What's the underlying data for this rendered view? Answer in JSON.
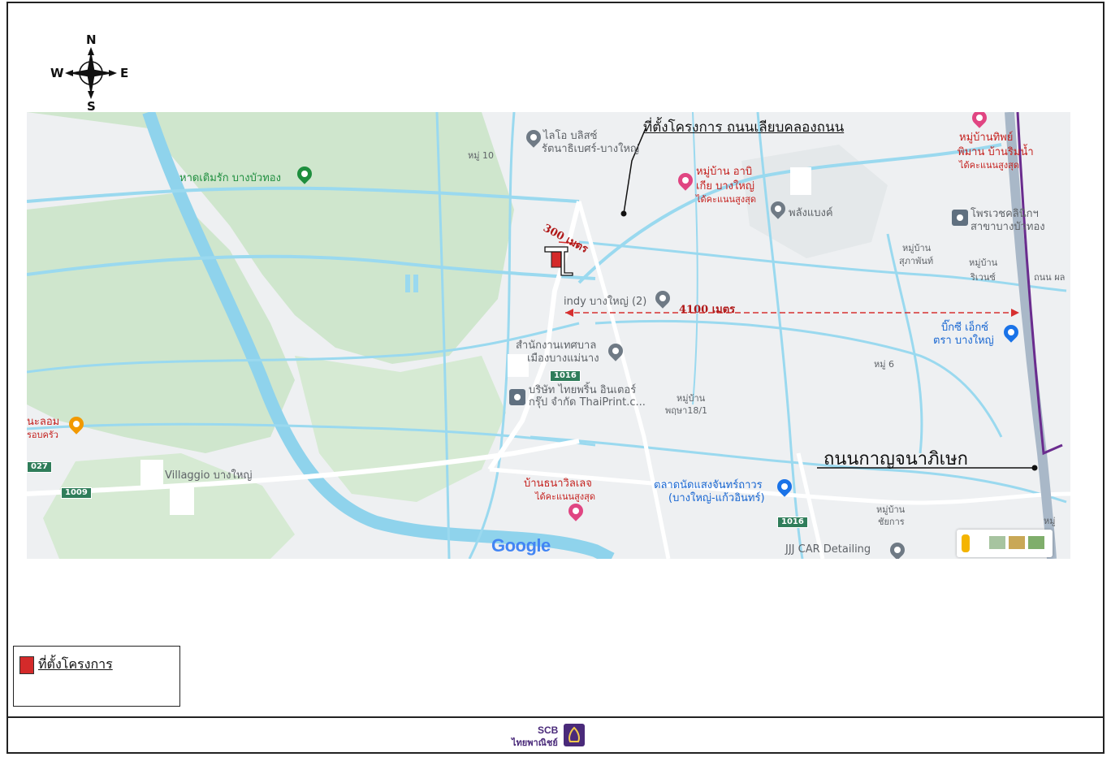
{
  "compass": {
    "north": "N",
    "south": "S",
    "east": "E",
    "west": "W"
  },
  "map": {
    "pois": [
      {
        "text": "ไลโอ บลิสซ์",
        "style": "grey"
      },
      {
        "text": "รัตนาธิเบศร์-บางใหญ่",
        "style": "grey"
      },
      {
        "text": "หมู่ 10",
        "style": "grey"
      },
      {
        "text": "หาดเติมรัก บางบัวทอง",
        "style": "green"
      },
      {
        "text": "หมู่บ้าน อาบิ",
        "style": "pink"
      },
      {
        "text": "เกีย บางใหญ่",
        "style": "pink"
      },
      {
        "text": "ได้คะแนนสูงสุด",
        "style": "pink"
      },
      {
        "text": "พลังแบงค์",
        "style": "grey"
      },
      {
        "text": "หมู่บ้านทิพย์",
        "style": "pink"
      },
      {
        "text": "พิมาน บ้านริมน้ำ",
        "style": "pink"
      },
      {
        "text": "ได้คะแนนสูงสุด",
        "style": "pink"
      },
      {
        "text": "โพรเวชคลินิกฯ",
        "style": "grey"
      },
      {
        "text": "สาขาบางบัวทอง",
        "style": "grey"
      },
      {
        "text": "หมู่บ้าน",
        "style": "grey"
      },
      {
        "text": "สุภาพันท์",
        "style": "grey"
      },
      {
        "text": "หมู่บ้าน",
        "style": "grey"
      },
      {
        "text": "ริเวนซ์",
        "style": "grey"
      },
      {
        "text": "ถนน ผล",
        "style": "grey"
      },
      {
        "text": "indy บางใหญ่ (2)",
        "style": "grey"
      },
      {
        "text": "บิ๊กซี เอ็กซ์",
        "style": "blue"
      },
      {
        "text": "ตรา บางใหญ่",
        "style": "blue"
      },
      {
        "text": "สำนักงานเทศบาล",
        "style": "grey"
      },
      {
        "text": "เมืองบางแม่นาง",
        "style": "grey"
      },
      {
        "text": "หมู่ 6",
        "style": "grey"
      },
      {
        "text": "บริษัท ไทยพริ้น อินเตอร์",
        "style": "grey"
      },
      {
        "text": "กรุ๊ป จำกัด ThaiPrint.c...",
        "style": "grey"
      },
      {
        "text": "หมู่บ้าน",
        "style": "grey"
      },
      {
        "text": "พฤษา18/1",
        "style": "grey"
      },
      {
        "text": "นะลอม",
        "style": "pink"
      },
      {
        "text": "รอบครัว",
        "style": "pink"
      },
      {
        "text": "Villaggio บางใหญ่",
        "style": "grey"
      },
      {
        "text": "บ้านธนาวิลเลจ",
        "style": "pink"
      },
      {
        "text": "ได้คะแนนสูงสุด",
        "style": "pink"
      },
      {
        "text": "ตลาดนัดแสงจันทร์ถาวร",
        "style": "blue"
      },
      {
        "text": "(บางใหญ่-แก้วอินทร์)",
        "style": "blue"
      },
      {
        "text": "หมู่บ้าน",
        "style": "grey"
      },
      {
        "text": "ชัยการ",
        "style": "grey"
      },
      {
        "text": "JJJ CAR Detailing",
        "style": "grey"
      },
      {
        "text": "หมู่",
        "style": "grey"
      }
    ],
    "road_shields": [
      "1016",
      "1016",
      "1009",
      "027"
    ],
    "attribution": "Google"
  },
  "annotations": {
    "site_callout": "ที่ตั้งโครงการ ถนนเลียบคลองถนน",
    "distance_near": "300 เมตร",
    "distance_far": "4100 เมตร",
    "main_road": "ถนนกาญจนาภิเษก"
  },
  "legend": {
    "label": "ที่ตั้งโครงการ"
  },
  "footer": {
    "brand_en": "SCB",
    "brand_th": "ไทยพาณิชย์"
  },
  "colors": {
    "site_marker": "#d42a2a",
    "distance_line": "#d63030",
    "river": "#8fd3ec",
    "green_area": "#cfe6cd",
    "brand": "#4a2a7a"
  }
}
